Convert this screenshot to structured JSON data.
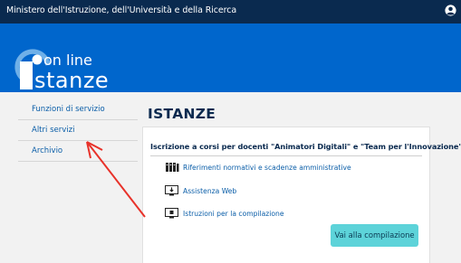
{
  "header": {
    "title": "Ministero dell'Istruzione, dell'Università e della Ricerca",
    "user_icon": "user-circle-icon"
  },
  "logo": {
    "line1": "on line",
    "line2": "stanze",
    "icon": "istanze-logo"
  },
  "sidebar": {
    "items": [
      {
        "label": "Funzioni di servizio"
      },
      {
        "label": "Altri servizi"
      },
      {
        "label": "Archivio"
      }
    ]
  },
  "main": {
    "title": "ISTANZE",
    "card": {
      "title": "Iscrizione a corsi per docenti \"Animatori Digitali\" e \"Team per l'Innovazione\"",
      "links": [
        {
          "label": "Riferimenti normativi e scadenze amministrative",
          "icon": "books-icon"
        },
        {
          "label": "Assistenza Web",
          "icon": "support-monitor-icon"
        },
        {
          "label": "Istruzioni per la compilazione",
          "icon": "instructions-monitor-icon"
        }
      ],
      "button_label": "Vai alla compilazione"
    }
  },
  "colors": {
    "topbar": "#0a2a4f",
    "banner": "#0066cc",
    "link": "#0b5ea8",
    "button": "#5dd3d9",
    "annotation_arrow": "#e8322a"
  }
}
